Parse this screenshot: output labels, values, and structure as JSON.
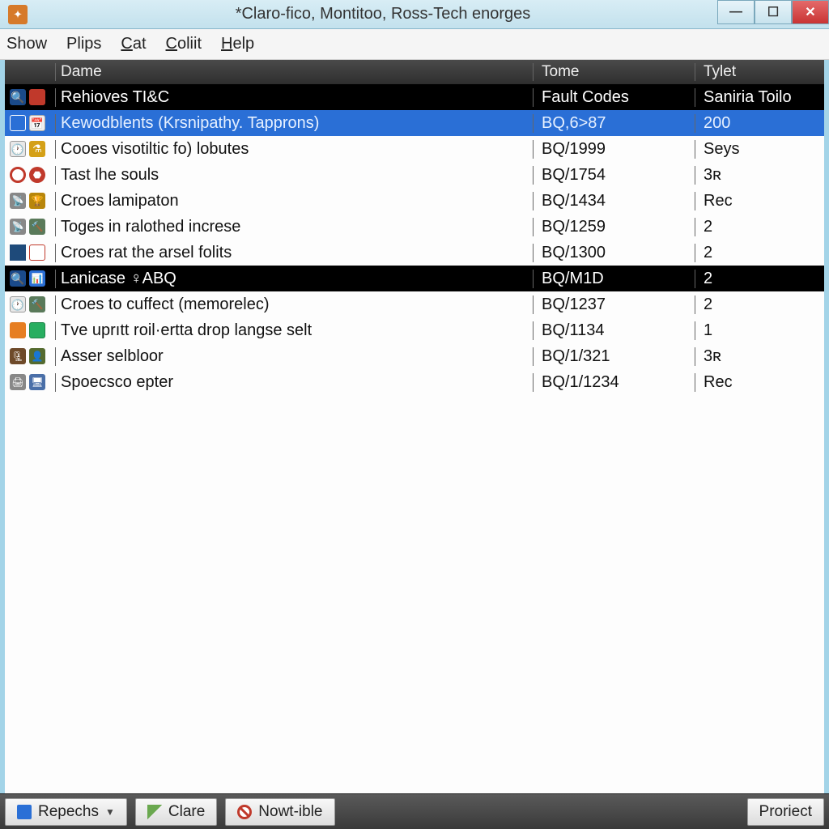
{
  "window": {
    "title": "*Claro-fico, Montitoo, Ross-Tech enorges"
  },
  "menu": {
    "show": "Show",
    "plips": "Plips",
    "cat": "Cat",
    "coliit": "Coliit",
    "help": "Help"
  },
  "columns": {
    "name": "Dame",
    "tome": "Tome",
    "tylet": "Tylet"
  },
  "rows": [
    {
      "state": "black",
      "icons": [
        "magnify",
        "redbox"
      ],
      "name": "Rehioves TI&C",
      "tome": "Fault Codes",
      "tylet": "Saniria Toilo"
    },
    {
      "state": "blue",
      "icons": [
        "blue",
        "cal"
      ],
      "name": "Kewodblents (Krsnipathy. Tapprons)",
      "tome": "BQ,6>87",
      "tylet": "200"
    },
    {
      "state": "",
      "icons": [
        "clock",
        "flask"
      ],
      "name": "Cooes visotiltic fo) lobutes",
      "tome": "BQ/1999",
      "tylet": "Seys"
    },
    {
      "state": "",
      "icons": [
        "redcirc",
        "stop"
      ],
      "name": "Tast lhe souls",
      "tome": "BQ/1754",
      "tylet": "3ʀ"
    },
    {
      "state": "",
      "icons": [
        "ant",
        "trophy"
      ],
      "name": "Croes lamipaton",
      "tome": "BQ/1434",
      "tylet": "Rec"
    },
    {
      "state": "",
      "icons": [
        "ant",
        "shovel"
      ],
      "name": "Toges in ralothed increse",
      "tome": "BQ/1259",
      "tylet": "2"
    },
    {
      "state": "",
      "icons": [
        "bluebar",
        "whitebox"
      ],
      "name": "Croes rat the arsel folits",
      "tome": "BQ/1300",
      "tylet": "2"
    },
    {
      "state": "black",
      "icons": [
        "magnify",
        "chart"
      ],
      "name": "Lanicase ♀ABQ",
      "tome": "BQ/M1D",
      "tylet": "2"
    },
    {
      "state": "",
      "icons": [
        "clock",
        "shovel"
      ],
      "name": "Croes to cuffect (memorelec)",
      "tome": "BQ/1237",
      "tylet": "2"
    },
    {
      "state": "",
      "icons": [
        "orange",
        "green"
      ],
      "name": "Tve uprıtt roil·ertta drop langse selt",
      "tome": "BQ/1134",
      "tylet": "1"
    },
    {
      "state": "",
      "icons": [
        "brown",
        "person"
      ],
      "name": "Asser selbloor",
      "tome": "BQ/1/321",
      "tylet": "3ʀ"
    },
    {
      "state": "",
      "icons": [
        "printer",
        "monitor"
      ],
      "name": "Spoecsco epter",
      "tome": "BQ/1/1234",
      "tylet": "Rec"
    }
  ],
  "status": {
    "repechs": "Repechs",
    "clare": "Clare",
    "nowtible": "Nowt-ible",
    "project": "Proriect"
  }
}
